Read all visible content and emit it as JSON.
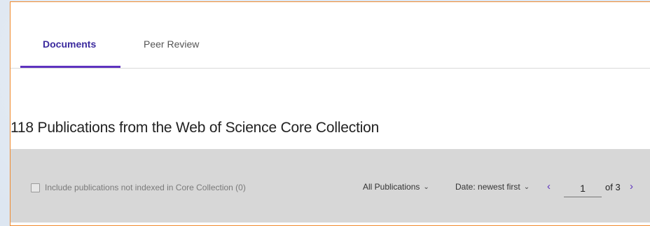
{
  "tabs": [
    {
      "label": "Documents",
      "active": true
    },
    {
      "label": "Peer Review",
      "active": false
    }
  ],
  "heading": "118 Publications from the Web of Science Core Collection",
  "filter": {
    "checkbox_label": "Include publications not indexed in Core Collection (0)",
    "checkbox_checked": false,
    "publications_dropdown": "All Publications",
    "sort_dropdown": "Date: newest first",
    "page_value": "1",
    "page_of": "of 3"
  },
  "icons": {
    "dropdown_chevron": "chevron-down-icon",
    "prev": "chevron-left-icon",
    "next": "chevron-right-icon"
  },
  "colors": {
    "accent": "#5e33bf",
    "active_tab_text": "#3b2a9e",
    "panel_border": "#f08a2e",
    "filter_bar_bg": "#d7d7d7"
  }
}
